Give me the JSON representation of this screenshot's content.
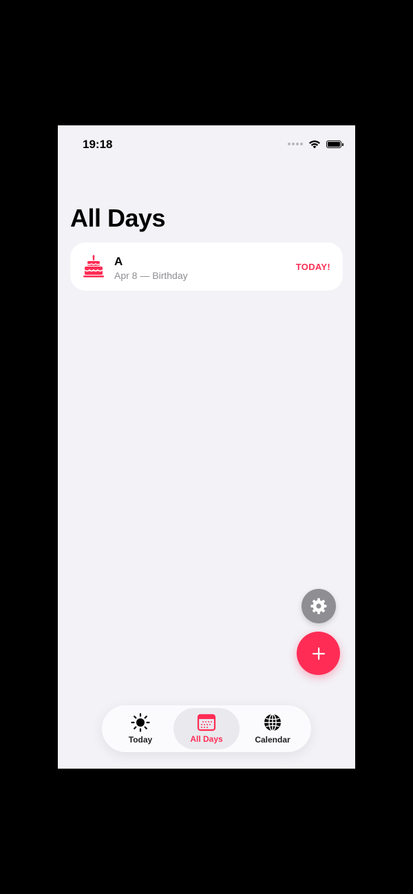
{
  "status_bar": {
    "time": "19:18"
  },
  "page": {
    "title": "All Days"
  },
  "days": [
    {
      "name": "A",
      "subtitle": "Apr 8 — Birthday",
      "badge": "TODAY!",
      "icon": "birthday-cake-icon"
    }
  ],
  "fab": {
    "settings_icon": "gear-icon",
    "add_icon": "plus-icon"
  },
  "tabbar": {
    "tabs": [
      {
        "label": "Today",
        "icon": "sun-icon",
        "active": false
      },
      {
        "label": "All Days",
        "icon": "calendar-icon",
        "active": true
      },
      {
        "label": "Calendar",
        "icon": "globe-icon",
        "active": false
      }
    ]
  },
  "colors": {
    "accent": "#ff2d55",
    "background": "#f2f2f7",
    "secondary_text": "#8e8e93"
  }
}
